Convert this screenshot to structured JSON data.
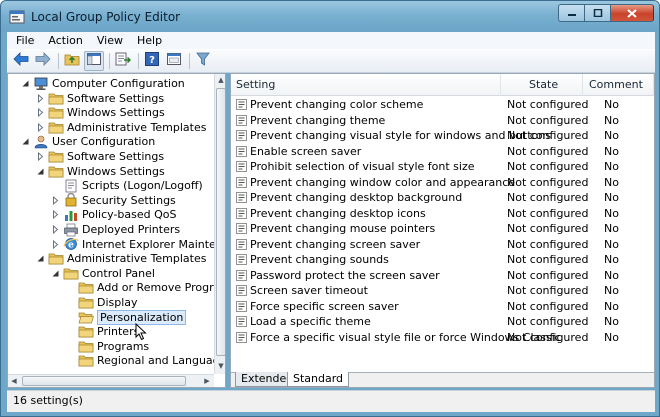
{
  "window": {
    "title": "Local Group Policy Editor"
  },
  "menubar": {
    "items": [
      "File",
      "Action",
      "View",
      "Help"
    ]
  },
  "tree": {
    "nodes": [
      {
        "label": "Computer Configuration",
        "level": 0,
        "expander": "expanded",
        "icon": "computer-icon"
      },
      {
        "label": "Software Settings",
        "level": 1,
        "expander": "collapsed",
        "icon": "folder-icon"
      },
      {
        "label": "Windows Settings",
        "level": 1,
        "expander": "collapsed",
        "icon": "folder-icon"
      },
      {
        "label": "Administrative Templates",
        "level": 1,
        "expander": "collapsed",
        "icon": "folder-icon"
      },
      {
        "label": "User Configuration",
        "level": 0,
        "expander": "expanded",
        "icon": "user-icon"
      },
      {
        "label": "Software Settings",
        "level": 1,
        "expander": "collapsed",
        "icon": "folder-icon"
      },
      {
        "label": "Windows Settings",
        "level": 1,
        "expander": "expanded",
        "icon": "folder-icon"
      },
      {
        "label": "Scripts (Logon/Logoff)",
        "level": 2,
        "expander": "none",
        "icon": "script-icon"
      },
      {
        "label": "Security Settings",
        "level": 2,
        "expander": "collapsed",
        "icon": "security-icon"
      },
      {
        "label": "Policy-based QoS",
        "level": 2,
        "expander": "collapsed",
        "icon": "chart-icon"
      },
      {
        "label": "Deployed Printers",
        "level": 2,
        "expander": "collapsed",
        "icon": "printer-icon"
      },
      {
        "label": "Internet Explorer Maintenance",
        "level": 2,
        "expander": "collapsed",
        "icon": "ie-icon"
      },
      {
        "label": "Administrative Templates",
        "level": 1,
        "expander": "expanded",
        "icon": "folder-icon"
      },
      {
        "label": "Control Panel",
        "level": 2,
        "expander": "expanded",
        "icon": "folder-icon"
      },
      {
        "label": "Add or Remove Programs",
        "level": 3,
        "expander": "none",
        "icon": "folder-icon"
      },
      {
        "label": "Display",
        "level": 3,
        "expander": "none",
        "icon": "folder-icon"
      },
      {
        "label": "Personalization",
        "level": 3,
        "expander": "none",
        "icon": "folder-open-icon",
        "selected": true
      },
      {
        "label": "Printers",
        "level": 3,
        "expander": "none",
        "icon": "folder-icon"
      },
      {
        "label": "Programs",
        "level": 3,
        "expander": "none",
        "icon": "folder-icon"
      },
      {
        "label": "Regional and Language Op",
        "level": 3,
        "expander": "none",
        "icon": "folder-icon"
      }
    ]
  },
  "list": {
    "columns": {
      "setting": "Setting",
      "state": "State",
      "comment": "Comment"
    },
    "rows": [
      {
        "name": "Prevent changing color scheme",
        "state": "Not configured",
        "comment": "No"
      },
      {
        "name": "Prevent changing theme",
        "state": "Not configured",
        "comment": "No"
      },
      {
        "name": "Prevent changing visual style for windows and buttons",
        "state": "Not configured",
        "comment": "No"
      },
      {
        "name": "Enable screen saver",
        "state": "Not configured",
        "comment": "No"
      },
      {
        "name": "Prohibit selection of visual style font size",
        "state": "Not configured",
        "comment": "No"
      },
      {
        "name": "Prevent changing window color and appearance",
        "state": "Not configured",
        "comment": "No"
      },
      {
        "name": "Prevent changing desktop background",
        "state": "Not configured",
        "comment": "No"
      },
      {
        "name": "Prevent changing desktop icons",
        "state": "Not configured",
        "comment": "No"
      },
      {
        "name": "Prevent changing mouse pointers",
        "state": "Not configured",
        "comment": "No"
      },
      {
        "name": "Prevent changing screen saver",
        "state": "Not configured",
        "comment": "No"
      },
      {
        "name": "Prevent changing sounds",
        "state": "Not configured",
        "comment": "No"
      },
      {
        "name": "Password protect the screen saver",
        "state": "Not configured",
        "comment": "No"
      },
      {
        "name": "Screen saver timeout",
        "state": "Not configured",
        "comment": "No"
      },
      {
        "name": "Force specific screen saver",
        "state": "Not configured",
        "comment": "No"
      },
      {
        "name": "Load a specific theme",
        "state": "Not configured",
        "comment": "No"
      },
      {
        "name": "Force a specific visual style file or force Windows Classic",
        "state": "Not configured",
        "comment": "No"
      }
    ],
    "tabs": [
      {
        "label": "Extended"
      },
      {
        "label": "Standard",
        "active": true
      }
    ]
  },
  "status": {
    "text": "16 setting(s)"
  },
  "colors": {
    "titlebar": "#79b0d0",
    "folder": "#e8c35a",
    "selection": "#dcebfc",
    "close_button": "#c9432b"
  }
}
